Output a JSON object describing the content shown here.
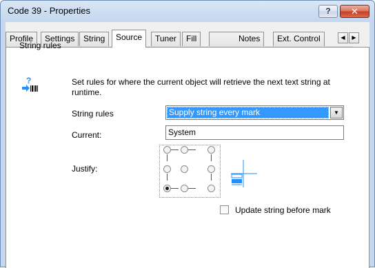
{
  "window": {
    "title": "Code 39 - Properties",
    "help_label": "?",
    "close_label": "✕"
  },
  "tabs": [
    {
      "label": "Profile",
      "active": false
    },
    {
      "label": "Settings",
      "active": false
    },
    {
      "label": "String",
      "active": false
    },
    {
      "label": "Source",
      "active": true
    },
    {
      "label": "Tuner",
      "active": false
    },
    {
      "label": "Fill",
      "active": false
    },
    {
      "label": "Notes",
      "active": false
    },
    {
      "label": "Ext. Control",
      "active": false
    }
  ],
  "tab_scroll": {
    "left": "◀",
    "right": "▶"
  },
  "group": {
    "label": "String rules",
    "icon": "string-rules-icon",
    "description": "Set rules for where the current object will retrieve the next text string at runtime."
  },
  "fields": {
    "string_rules_label": "String rules",
    "string_rules_value": "Supply string every mark",
    "current_label": "Current:",
    "current_value": "System",
    "justify_label": "Justify:"
  },
  "justify": {
    "selected": "bottom-left"
  },
  "update_string": {
    "label": "Update string before mark",
    "checked": false
  },
  "colors": {
    "selection": "#3399ff",
    "accent_icon": "#1e90ff"
  }
}
